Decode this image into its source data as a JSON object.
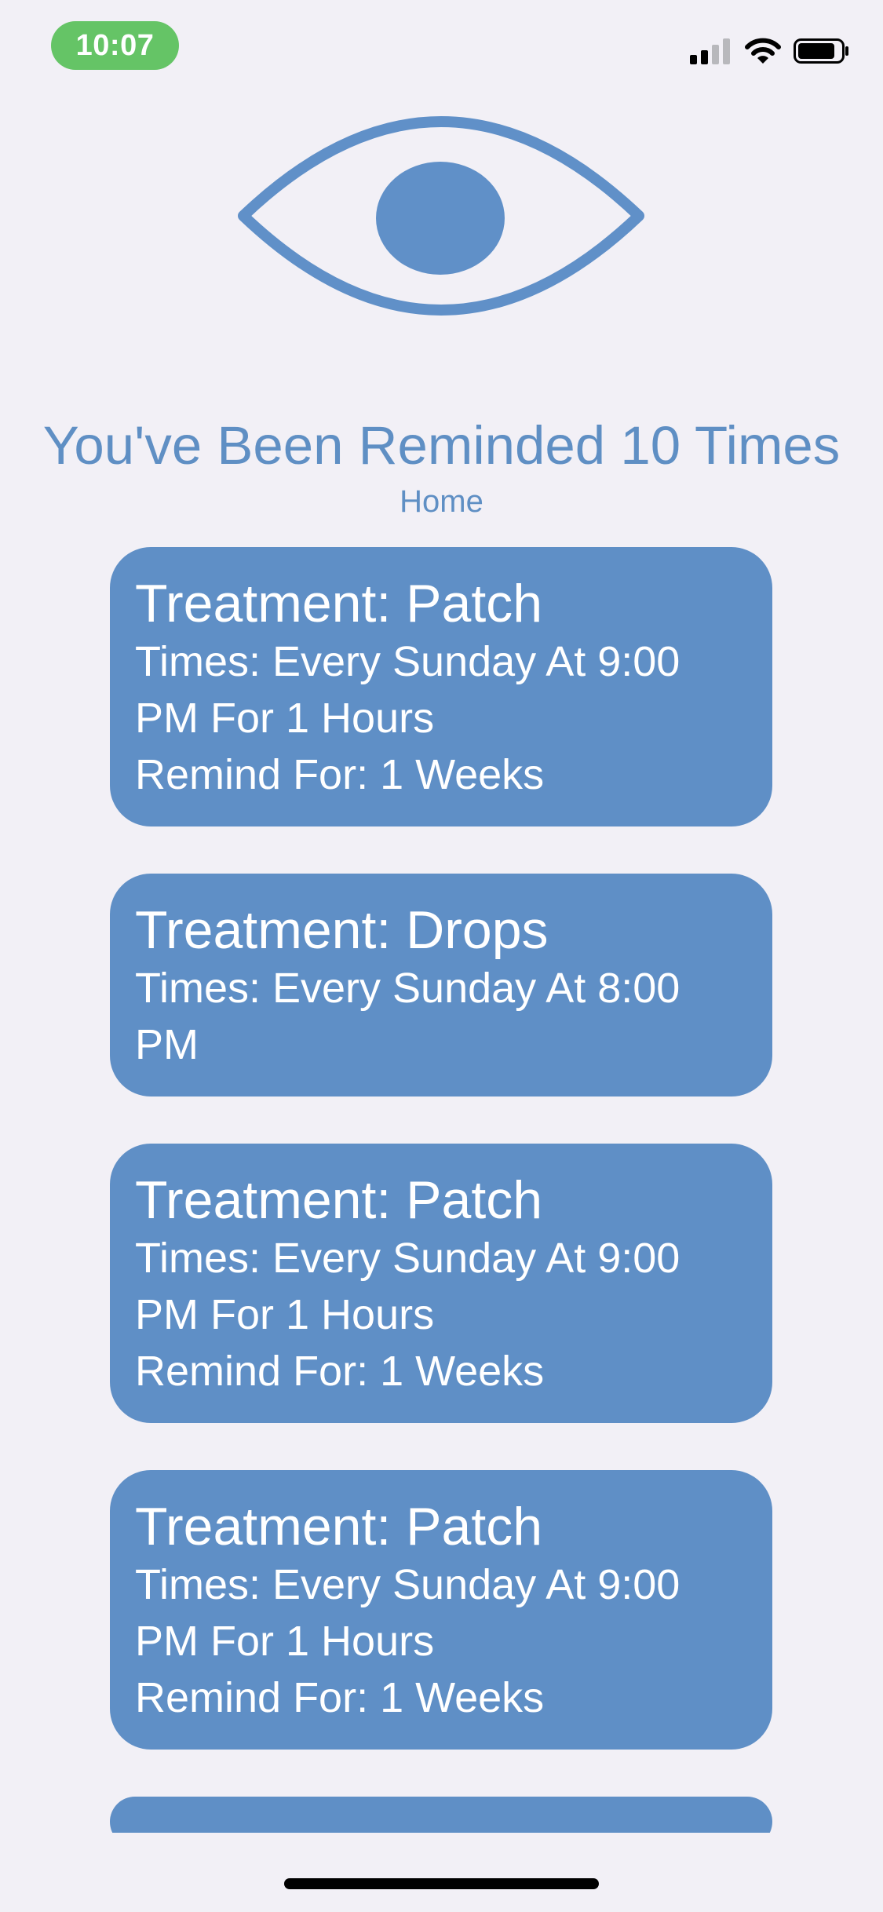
{
  "status_bar": {
    "time": "10:07",
    "pill_color": "#65c466",
    "icons": [
      "cellular-signal-icon",
      "wifi-icon",
      "battery-icon"
    ]
  },
  "header": {
    "logo_icon": "eye-icon",
    "headline": "You've Been Reminded 10 Times",
    "subtitle": "Home"
  },
  "colors": {
    "accent": "#5f8fc4",
    "card": "#5f8fc6",
    "background": "#f2f0f6"
  },
  "reminders": [
    {
      "title": "Treatment: Patch",
      "times": "Times: Every Sunday At 9:00 PM For 1 Hours",
      "remind_for": "Remind For: 1 Weeks"
    },
    {
      "title": "Treatment: Drops",
      "times": "Times: Every Sunday At 8:00 PM"
    },
    {
      "title": "Treatment: Patch",
      "times": "Times: Every Sunday At 9:00 PM For 1 Hours",
      "remind_for": "Remind For: 1 Weeks"
    },
    {
      "title": "Treatment: Patch",
      "times": "Times: Every Sunday At 9:00 PM For 1 Hours",
      "remind_for": "Remind For: 1 Weeks"
    },
    {
      "title": "",
      "times": ""
    }
  ]
}
